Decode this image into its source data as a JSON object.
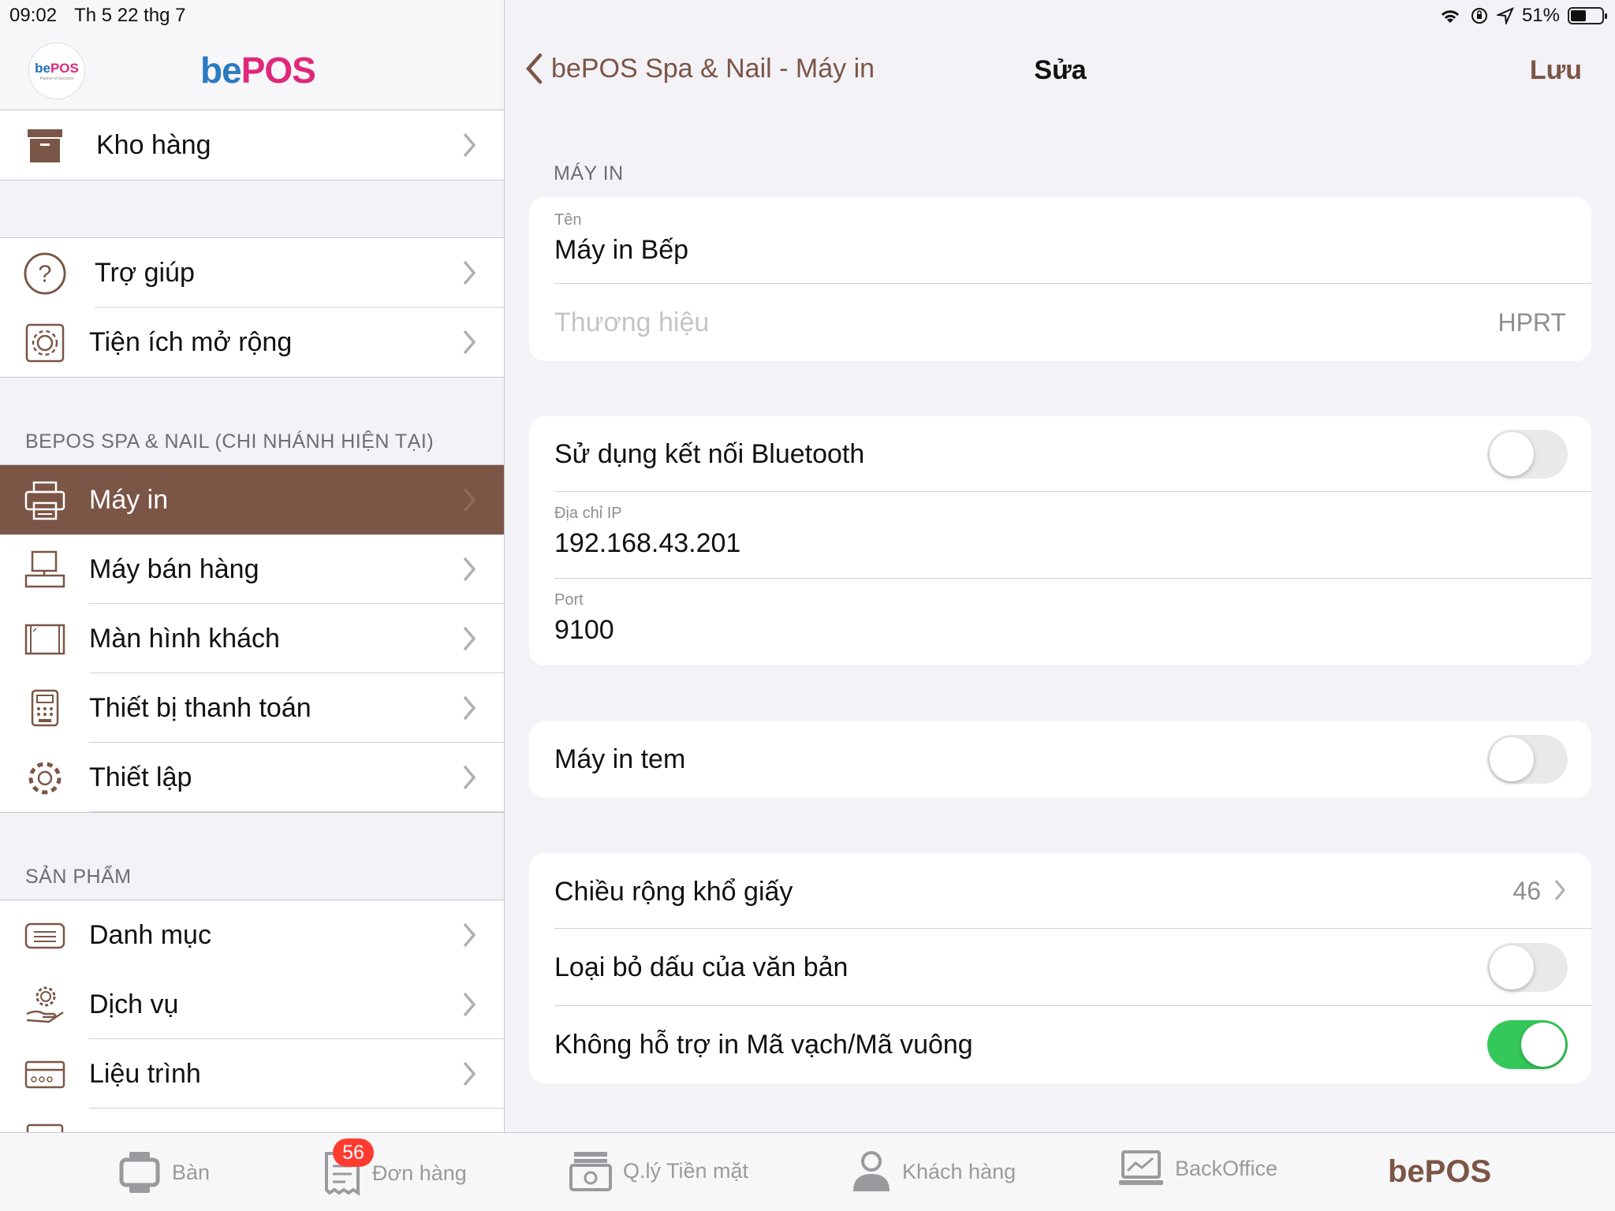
{
  "status": {
    "time": "09:02",
    "date": "Th 5 22 thg 7",
    "battery": "51%",
    "battery_level": 0.51
  },
  "brand": {
    "logo_small_be": "be",
    "logo_small_pos": "POS",
    "logo_small_tag": "Partner of Success",
    "logo_big_be": "be",
    "logo_big_pos": "POS"
  },
  "sidebar": {
    "top_group": [
      {
        "label": "Kho hàng",
        "icon": "archive-box-icon"
      }
    ],
    "help_group": [
      {
        "label": "Trợ giúp",
        "icon": "question-circle-icon"
      },
      {
        "label": "Tiện ích mở rộng",
        "icon": "gear-box-icon"
      }
    ],
    "branch_header": "BEPOS SPA & NAIL (CHI NHÁNH HIỆN TẠI)",
    "branch_group": [
      {
        "label": "Máy in",
        "icon": "printer-icon",
        "selected": true
      },
      {
        "label": "Máy bán hàng",
        "icon": "pos-terminal-icon"
      },
      {
        "label": "Màn hình khách",
        "icon": "customer-display-icon"
      },
      {
        "label": "Thiết bị thanh toán",
        "icon": "payment-device-icon"
      },
      {
        "label": "Thiết lập",
        "icon": "gear-icon"
      }
    ],
    "products_header": "SẢN PHẨM",
    "products_group": [
      {
        "label": "Danh mục",
        "icon": "category-icon"
      },
      {
        "label": "Dịch vụ",
        "icon": "service-icon"
      },
      {
        "label": "Liệu trình",
        "icon": "treatment-card-icon"
      }
    ]
  },
  "nav": {
    "back_label": "bePOS Spa & Nail - Máy in",
    "title": "Sửa",
    "save_label": "Lưu"
  },
  "form": {
    "printer_section": "MÁY IN",
    "name_caption": "Tên",
    "name_value": "Máy in Bếp",
    "brand_placeholder": "Thương hiệu",
    "brand_value": "HPRT",
    "bluetooth_label": "Sử dụng kết nối Bluetooth",
    "bluetooth_on": false,
    "ip_caption": "Địa chỉ IP",
    "ip_value": "192.168.43.201",
    "port_caption": "Port",
    "port_value": "9100",
    "label_printer_label": "Máy in tem",
    "label_printer_on": false,
    "paper_width_label": "Chiều rộng khổ giấy",
    "paper_width_value": "46",
    "remove_accents_label": "Loại bỏ dấu của văn bản",
    "remove_accents_on": false,
    "no_barcode_label": "Không hỗ trợ in Mã vạch/Mã vuông",
    "no_barcode_on": true
  },
  "tabs": [
    {
      "label": "Bàn",
      "icon": "table-icon"
    },
    {
      "label": "Đơn hàng",
      "icon": "orders-icon",
      "badge": "56"
    },
    {
      "label": "Q.lý Tiền mặt",
      "icon": "cash-register-icon"
    },
    {
      "label": "Khách hàng",
      "icon": "person-icon"
    },
    {
      "label": "BackOffice",
      "icon": "laptop-chart-icon"
    }
  ],
  "tab_brand": "bePOS",
  "colors": {
    "accent": "#7b5545",
    "toggle_on": "#34c759",
    "badge": "#ff3b30"
  }
}
